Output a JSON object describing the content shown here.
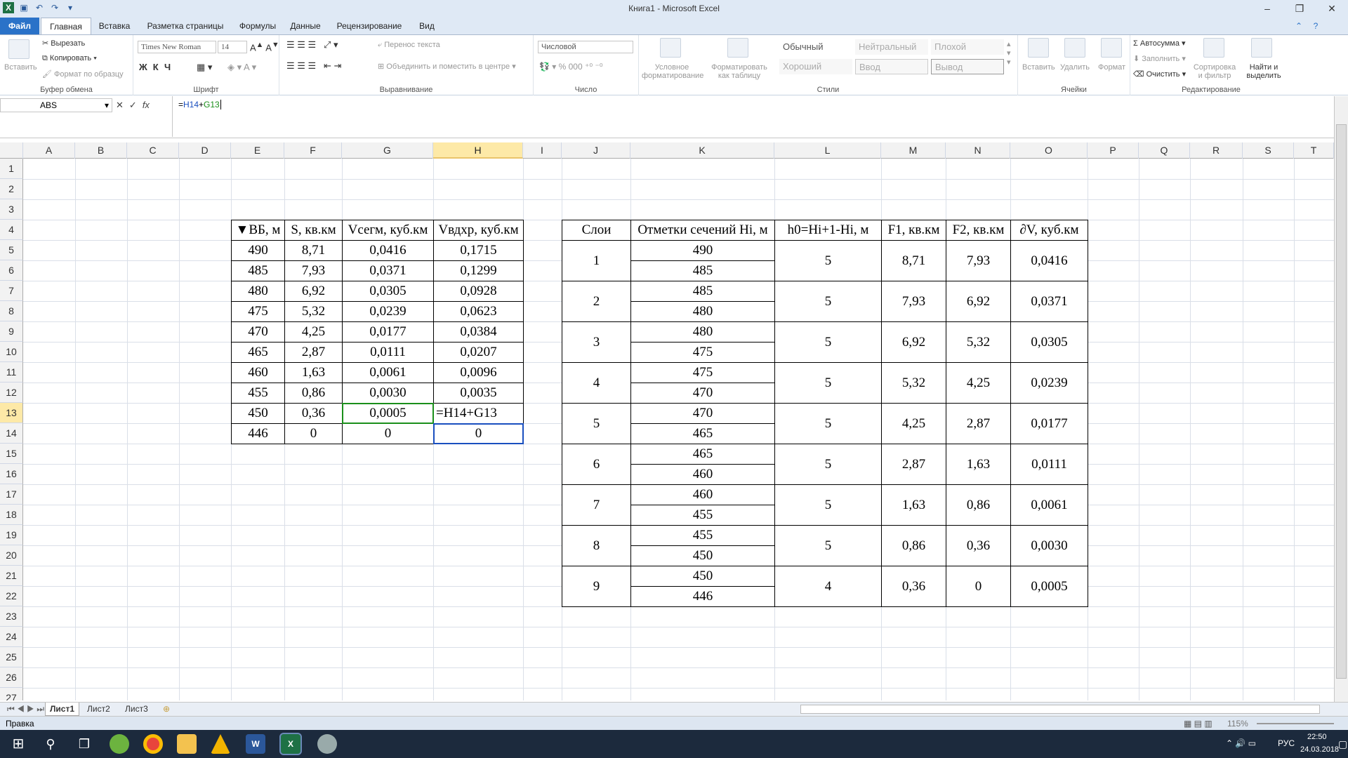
{
  "window": {
    "title": "Книга1 - Microsoft Excel",
    "min": "–",
    "max": "❐",
    "close": "✕"
  },
  "tabs": [
    "Файл",
    "Главная",
    "Вставка",
    "Разметка страницы",
    "Формулы",
    "Данные",
    "Рецензирование",
    "Вид"
  ],
  "ribbon": {
    "clipboard": {
      "label": "Буфер обмена",
      "paste": "Вставить",
      "cut": "Вырезать",
      "copy": "Копировать",
      "format_painter": "Формат по образцу"
    },
    "font": {
      "label": "Шрифт",
      "name": "Times New Roman",
      "size": "14"
    },
    "align": {
      "label": "Выравнивание",
      "wrap": "Перенос текста",
      "merge": "Объединить и поместить в центре"
    },
    "number": {
      "label": "Число",
      "format": "Числовой"
    },
    "styles": {
      "label": "Стили",
      "cond": "Условное форматирование",
      "table": "Форматировать как таблицу",
      "normal": "Обычный",
      "neutral": "Нейтральный",
      "bad": "Плохой",
      "good": "Хороший",
      "input": "Ввод",
      "output": "Вывод"
    },
    "cells": {
      "label": "Ячейки",
      "insert": "Вставить",
      "delete": "Удалить",
      "format": "Формат"
    },
    "edit": {
      "label": "Редактирование",
      "autosum": "Автосумма",
      "fill": "Заполнить",
      "clear": "Очистить",
      "sort": "Сортировка и фильтр",
      "find": "Найти и выделить"
    }
  },
  "formula_bar": {
    "namebox": "ABS",
    "formula_prefix": "=",
    "ref1": "H14",
    "op": "+",
    "ref2": "G13"
  },
  "columns": [
    "A",
    "B",
    "C",
    "D",
    "E",
    "F",
    "G",
    "H",
    "I",
    "J",
    "K",
    "L",
    "M",
    "N",
    "O",
    "P",
    "Q",
    "R",
    "S",
    "T"
  ],
  "rows": [
    "1",
    "2",
    "3",
    "4",
    "5",
    "6",
    "7",
    "8",
    "9",
    "10",
    "11",
    "12",
    "13",
    "14",
    "15",
    "16",
    "17",
    "18",
    "19",
    "20",
    "21",
    "22",
    "23",
    "24",
    "25",
    "26",
    "27"
  ],
  "table1": {
    "headers": [
      "▼ВБ, м",
      "S, кв.км",
      "Vсегм, куб.км",
      "Vвдхр, куб.км"
    ],
    "rows": [
      [
        "490",
        "8,71",
        "0,0416",
        "0,1715"
      ],
      [
        "485",
        "7,93",
        "0,0371",
        "0,1299"
      ],
      [
        "480",
        "6,92",
        "0,0305",
        "0,0928"
      ],
      [
        "475",
        "5,32",
        "0,0239",
        "0,0623"
      ],
      [
        "470",
        "4,25",
        "0,0177",
        "0,0384"
      ],
      [
        "465",
        "2,87",
        "0,0111",
        "0,0207"
      ],
      [
        "460",
        "1,63",
        "0,0061",
        "0,0096"
      ],
      [
        "455",
        "0,86",
        "0,0030",
        "0,0035"
      ],
      [
        "450",
        "0,36",
        "0,0005",
        "=H14+G13"
      ],
      [
        "446",
        "0",
        "0",
        "0"
      ]
    ]
  },
  "table2": {
    "headers": [
      "Слои",
      "Отметки сечений Hi, м",
      "h0=Hi+1-Hi, м",
      "F1, кв.км",
      "F2, кв.км",
      "∂V, куб.км"
    ],
    "layers": [
      {
        "n": "1",
        "hi": [
          "490",
          "485"
        ],
        "h0": "5",
        "f1": "8,71",
        "f2": "7,93",
        "dv": "0,0416"
      },
      {
        "n": "2",
        "hi": [
          "485",
          "480"
        ],
        "h0": "5",
        "f1": "7,93",
        "f2": "6,92",
        "dv": "0,0371"
      },
      {
        "n": "3",
        "hi": [
          "480",
          "475"
        ],
        "h0": "5",
        "f1": "6,92",
        "f2": "5,32",
        "dv": "0,0305"
      },
      {
        "n": "4",
        "hi": [
          "475",
          "470"
        ],
        "h0": "5",
        "f1": "5,32",
        "f2": "4,25",
        "dv": "0,0239"
      },
      {
        "n": "5",
        "hi": [
          "470",
          "465"
        ],
        "h0": "5",
        "f1": "4,25",
        "f2": "2,87",
        "dv": "0,0177"
      },
      {
        "n": "6",
        "hi": [
          "465",
          "460"
        ],
        "h0": "5",
        "f1": "2,87",
        "f2": "1,63",
        "dv": "0,0111"
      },
      {
        "n": "7",
        "hi": [
          "460",
          "455"
        ],
        "h0": "5",
        "f1": "1,63",
        "f2": "0,86",
        "dv": "0,0061"
      },
      {
        "n": "8",
        "hi": [
          "455",
          "450"
        ],
        "h0": "5",
        "f1": "0,86",
        "f2": "0,36",
        "dv": "0,0030"
      },
      {
        "n": "9",
        "hi": [
          "450",
          "446"
        ],
        "h0": "4",
        "f1": "0,36",
        "f2": "0",
        "dv": "0,0005"
      }
    ]
  },
  "sheets": [
    "Лист1",
    "Лист2",
    "Лист3"
  ],
  "status": {
    "mode": "Правка",
    "zoom": "115%"
  },
  "taskbar": {
    "lang": "РУС",
    "time": "22:50",
    "date": "24.03.2018"
  }
}
